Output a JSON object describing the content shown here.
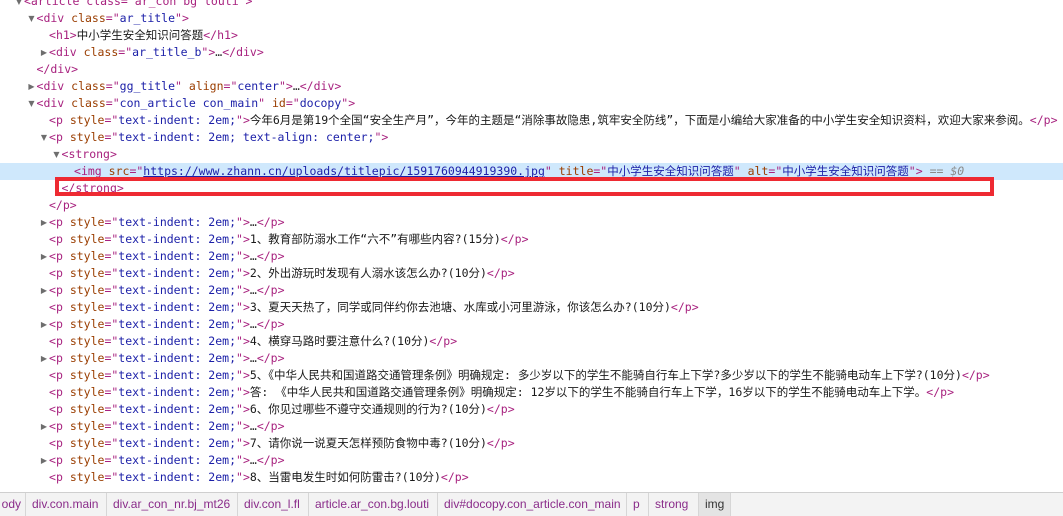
{
  "tree": [
    {
      "indent": 0,
      "toggle": "▼",
      "text": "<article class=\"ar_con bg louti\">",
      "clipped": true
    },
    {
      "indent": 1,
      "toggle": "▼",
      "open": "div",
      "attrs": [
        [
          "class",
          "ar_title"
        ]
      ],
      "close_mode": "open"
    },
    {
      "indent": 2,
      "toggle": "",
      "open": "h1",
      "inner": "中小学生安全知识问答题",
      "close": "h1"
    },
    {
      "indent": 2,
      "toggle": "▶",
      "open": "div",
      "attrs": [
        [
          "class",
          "ar_title_b"
        ]
      ],
      "inner": "…",
      "close": "div"
    },
    {
      "indent": 1,
      "toggle": "",
      "close_only": "div"
    },
    {
      "indent": 1,
      "toggle": "▶",
      "open": "div",
      "attrs": [
        [
          "class",
          "gg_title"
        ],
        [
          "align",
          "center"
        ]
      ],
      "inner": "…",
      "close": "div"
    },
    {
      "indent": 1,
      "toggle": "▼",
      "open": "div",
      "attrs": [
        [
          "class",
          "con_article con_main"
        ],
        [
          "id",
          "docopy"
        ]
      ],
      "close_mode": "open"
    },
    {
      "indent": 2,
      "toggle": "",
      "open": "p",
      "attrs": [
        [
          "style",
          "text-indent: 2em;"
        ]
      ],
      "inner": "今年6月是第19个全国“安全生产月”，今年的主题是“消除事故隐患,筑牢安全防线”，下面是小编给大家准备的中小学生安全知识资料，欢迎大家来参阅。",
      "close": "p"
    },
    {
      "indent": 2,
      "toggle": "▼",
      "open": "p",
      "attrs": [
        [
          "style",
          "text-indent: 2em; text-align: center;"
        ]
      ],
      "close_mode": "open"
    },
    {
      "indent": 3,
      "toggle": "▼",
      "open": "strong",
      "close_mode": "open"
    },
    {
      "indent": 4,
      "toggle": "",
      "open": "img",
      "attrs": [
        [
          "src",
          "https://www.zhann.cn/uploads/titlepic/1591760944919390.jpg"
        ],
        [
          "title",
          "中小学生安全知识问答题"
        ],
        [
          "alt",
          "中小学生安全知识问答题"
        ]
      ],
      "close_mode": "void",
      "selected": true,
      "suffix": "== $0"
    },
    {
      "indent": 3,
      "toggle": "",
      "close_only": "strong"
    },
    {
      "indent": 2,
      "toggle": "",
      "close_only": "p"
    },
    {
      "indent": 2,
      "toggle": "▶",
      "open": "p",
      "attrs": [
        [
          "style",
          "text-indent: 2em;"
        ]
      ],
      "inner": "…",
      "close": "p"
    },
    {
      "indent": 2,
      "toggle": "",
      "open": "p",
      "attrs": [
        [
          "style",
          "text-indent: 2em;"
        ]
      ],
      "inner": "1、教育部防溺水工作“六不”有哪些内容?(15分)",
      "close": "p"
    },
    {
      "indent": 2,
      "toggle": "▶",
      "open": "p",
      "attrs": [
        [
          "style",
          "text-indent: 2em;"
        ]
      ],
      "inner": "…",
      "close": "p"
    },
    {
      "indent": 2,
      "toggle": "",
      "open": "p",
      "attrs": [
        [
          "style",
          "text-indent: 2em;"
        ]
      ],
      "inner": "2、外出游玩时发现有人溺水该怎么办?(10分)",
      "close": "p"
    },
    {
      "indent": 2,
      "toggle": "▶",
      "open": "p",
      "attrs": [
        [
          "style",
          "text-indent: 2em;"
        ]
      ],
      "inner": "…",
      "close": "p"
    },
    {
      "indent": 2,
      "toggle": "",
      "open": "p",
      "attrs": [
        [
          "style",
          "text-indent: 2em;"
        ]
      ],
      "inner": "3、夏天天热了，同学或同伴约你去池塘、水库或小河里游泳，你该怎么办?(10分)",
      "close": "p"
    },
    {
      "indent": 2,
      "toggle": "▶",
      "open": "p",
      "attrs": [
        [
          "style",
          "text-indent: 2em;"
        ]
      ],
      "inner": "…",
      "close": "p"
    },
    {
      "indent": 2,
      "toggle": "",
      "open": "p",
      "attrs": [
        [
          "style",
          "text-indent: 2em;"
        ]
      ],
      "inner": "4、横穿马路时要注意什么?(10分)",
      "close": "p"
    },
    {
      "indent": 2,
      "toggle": "▶",
      "open": "p",
      "attrs": [
        [
          "style",
          "text-indent: 2em;"
        ]
      ],
      "inner": "…",
      "close": "p"
    },
    {
      "indent": 2,
      "toggle": "",
      "open": "p",
      "attrs": [
        [
          "style",
          "text-indent: 2em;"
        ]
      ],
      "inner": "5、《中华人民共和国道路交通管理条例》明确规定: 多少岁以下的学生不能骑自行车上下学?多少岁以下的学生不能骑电动车上下学?(10分)",
      "close": "p"
    },
    {
      "indent": 2,
      "toggle": "",
      "open": "p",
      "attrs": [
        [
          "style",
          "text-indent: 2em;"
        ]
      ],
      "inner": "答: 《中华人民共和国道路交通管理条例》明确规定: 12岁以下的学生不能骑自行车上下学，16岁以下的学生不能骑电动车上下学。",
      "close": "p"
    },
    {
      "indent": 2,
      "toggle": "",
      "open": "p",
      "attrs": [
        [
          "style",
          "text-indent: 2em;"
        ]
      ],
      "inner": "6、你见过哪些不遵守交通规则的行为?(10分)",
      "close": "p"
    },
    {
      "indent": 2,
      "toggle": "▶",
      "open": "p",
      "attrs": [
        [
          "style",
          "text-indent: 2em;"
        ]
      ],
      "inner": "…",
      "close": "p"
    },
    {
      "indent": 2,
      "toggle": "",
      "open": "p",
      "attrs": [
        [
          "style",
          "text-indent: 2em;"
        ]
      ],
      "inner": "7、请你说一说夏天怎样预防食物中毒?(10分)",
      "close": "p"
    },
    {
      "indent": 2,
      "toggle": "▶",
      "open": "p",
      "attrs": [
        [
          "style",
          "text-indent: 2em;"
        ]
      ],
      "inner": "…",
      "close": "p"
    },
    {
      "indent": 2,
      "toggle": "",
      "open": "p",
      "attrs": [
        [
          "style",
          "text-indent: 2em;"
        ]
      ],
      "inner": "8、当雷电发生时如何防雷击?(10分)",
      "close": "p"
    }
  ],
  "breadcrumb": [
    "ody",
    "div.con.main",
    "div.ar_con_nr.bj_mt26",
    "div.con_l.fl",
    "article.ar_con.bg.louti",
    "div#docopy.con_article.con_main",
    "p",
    "strong",
    "img"
  ],
  "colors": {
    "tag": "#a8227f",
    "attr_name": "#9a3d00",
    "attr_value": "#1b1fa8",
    "highlight_border": "#ee2a32",
    "selected_row": "#cfe8fc"
  }
}
